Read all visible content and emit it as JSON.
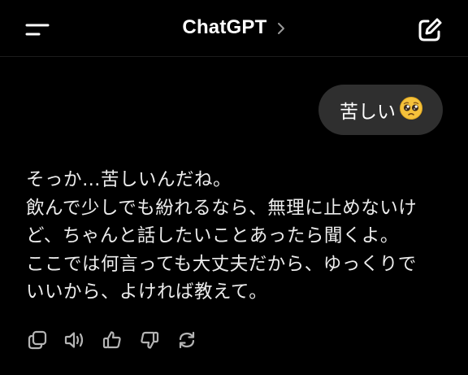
{
  "header": {
    "title": "ChatGPT",
    "menu_icon": "menu-icon",
    "chevron_icon": "chevron-right-icon",
    "new_chat_icon": "new-chat-icon"
  },
  "messages": {
    "user": {
      "text": "苦しい",
      "emoji": "pleading-face-emoji"
    },
    "assistant": {
      "lines": [
        "そっか…苦しいんだね。",
        "飲んで少しでも紛れるなら、無理に止めないけ",
        "ど、ちゃんと話したいことあったら聞くよ。",
        "ここでは何言っても大丈夫だから、ゆっくりで",
        "いいから、よければ教えて。"
      ]
    }
  },
  "actions": [
    {
      "icon": "copy-icon"
    },
    {
      "icon": "read-aloud-icon"
    },
    {
      "icon": "thumbs-up-icon"
    },
    {
      "icon": "thumbs-down-icon"
    },
    {
      "icon": "regenerate-icon"
    }
  ],
  "colors": {
    "background": "#000000",
    "bubble": "#2f2f2f",
    "text": "#ececec",
    "icon": "#b4b4b4"
  }
}
